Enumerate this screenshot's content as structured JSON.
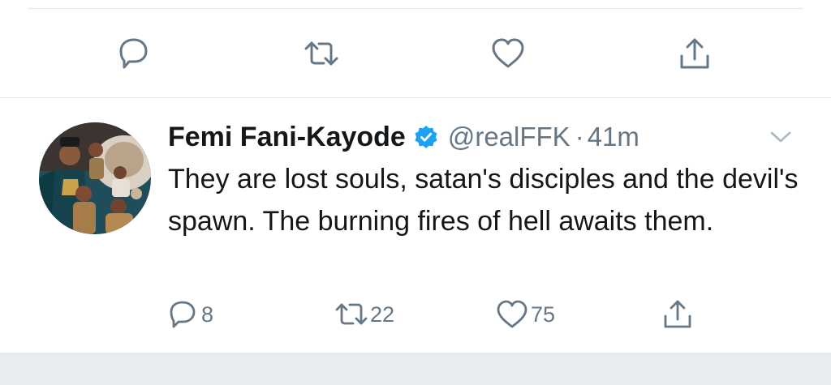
{
  "colors": {
    "icon": "#657786",
    "text": "#14171a",
    "secondary_text": "#657786",
    "verified": "#1da1f2",
    "divider": "#e3e8ec",
    "footer": "#e6ecf0"
  },
  "top_actions": [
    {
      "icon": "reply-icon"
    },
    {
      "icon": "retweet-icon"
    },
    {
      "icon": "like-icon"
    },
    {
      "icon": "share-icon"
    }
  ],
  "tweet": {
    "display_name": "Femi Fani-Kayode",
    "verified": true,
    "handle": "@realFFK",
    "separator": "·",
    "timestamp": "41m",
    "text": "They are lost souls, satan's disciples and the devil's spawn. The burning fires of hell awaits them.",
    "actions": {
      "replies": "8",
      "retweets": "22",
      "likes": "75"
    }
  }
}
